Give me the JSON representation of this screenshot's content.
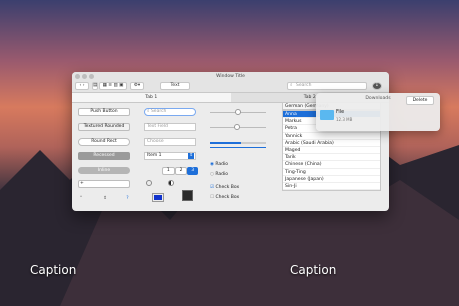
{
  "window": {
    "title": "Window Title"
  },
  "toolbar": {
    "text_button": "Text",
    "search_placeholder": "Search"
  },
  "tabs": [
    {
      "label": "Tab 1"
    },
    {
      "label": "Tab 2"
    }
  ],
  "controls": {
    "push_button": "Push Button",
    "textured_button": "Textured Rounded",
    "round_rect": "Round Rect",
    "recessed": "Recessed",
    "inline": "Inline",
    "search_field_placeholder": "Search",
    "text_field_placeholder": "Text Field",
    "combo_placeholder": "Choose",
    "popup_value": "Item 1",
    "segments": [
      "1",
      "2",
      "3"
    ],
    "radio_1": "Radio",
    "radio_2": "Radio",
    "checkbox_1": "Check Box",
    "checkbox_2": "Check Box",
    "slider_level": 0.5,
    "progress_level": 0.55
  },
  "languages": {
    "header": "German (Germany)",
    "items": [
      "Anna",
      "Markus",
      "Petra",
      "Yannick",
      "Arabic (Saudi Arabia)",
      "Maged",
      "Tarik",
      "Chinese (China)",
      "Ting-Ting",
      "Japanese (Japan)",
      "Sin-Ji"
    ],
    "selected_index": 0
  },
  "downloads": {
    "title": "Downloads",
    "delete_label": "Delete",
    "file_name": "File",
    "file_size": "12.3 MB"
  },
  "captions": {
    "left": "Caption",
    "right": "Caption"
  },
  "colors": {
    "accent": "#1e6fd9",
    "folder": "#5ab8f0",
    "swatch_blue": "#1133cc",
    "swatch_dark": "#2a2a2a"
  }
}
